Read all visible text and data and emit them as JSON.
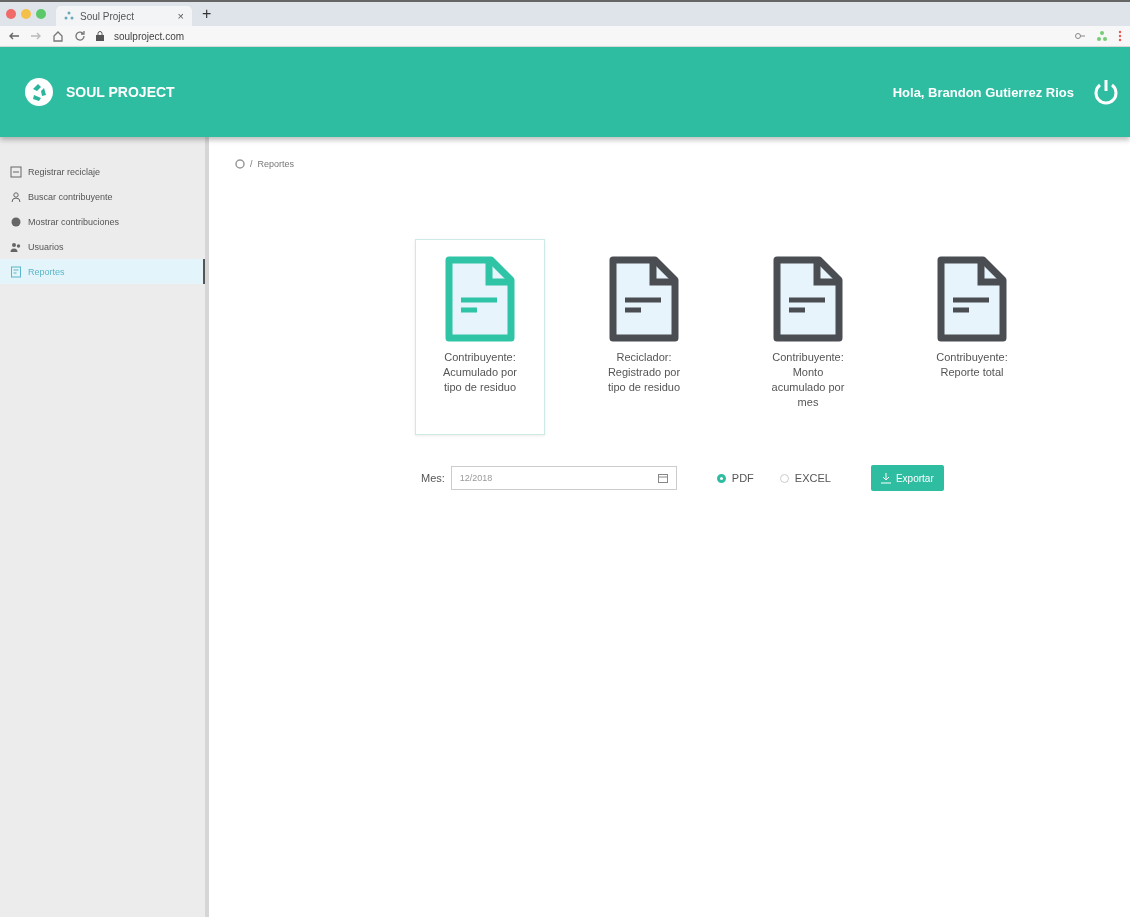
{
  "browser": {
    "tab_title": "Soul Project",
    "tab_close": "×",
    "new_tab": "+",
    "url": "soulproject.com"
  },
  "header": {
    "brand": "SOUL PROJECT",
    "greeting": "Hola, Brandon Gutierrez Rios"
  },
  "sidebar": {
    "items": [
      {
        "label": "Registrar reciclaje",
        "selected": false
      },
      {
        "label": "Buscar contribuyente",
        "selected": false
      },
      {
        "label": "Mostrar contribuciones",
        "selected": false
      },
      {
        "label": "Usuarios",
        "selected": false
      },
      {
        "label": "Reportes",
        "selected": true
      }
    ]
  },
  "breadcrumb": {
    "separator": "/",
    "current": "Reportes"
  },
  "reports": [
    {
      "label": "Contribuyente: Acumulado por tipo de residuo",
      "selected": true
    },
    {
      "label": "Reciclador: Registrado por tipo de residuo",
      "selected": false
    },
    {
      "label": "Contribuyente: Monto acumulado por mes",
      "selected": false
    },
    {
      "label": "Contribuyente: Reporte total",
      "selected": false
    }
  ],
  "form": {
    "month_label": "Mes:",
    "month_value": "12/2018",
    "formats": [
      {
        "label": "PDF",
        "selected": true
      },
      {
        "label": "EXCEL",
        "selected": false
      }
    ],
    "export_button": "Exportar"
  }
}
